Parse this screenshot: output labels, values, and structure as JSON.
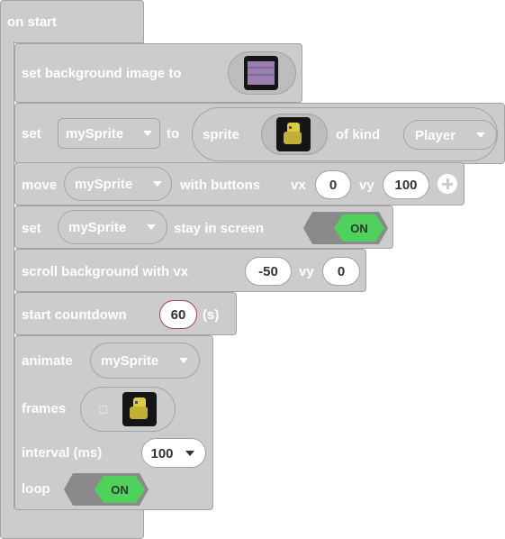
{
  "hat": {
    "label": "on start"
  },
  "blocks": {
    "set_bg": {
      "label": "set background image to",
      "image_icon": "background-image-thumbnail"
    },
    "set_sprite": {
      "set": "set",
      "variable": "mySprite",
      "to": "to",
      "sprite": "sprite",
      "sprite_icon": "player-sprite-thumbnail",
      "of_kind": "of kind",
      "kind": "Player"
    },
    "move": {
      "move": "move",
      "variable": "mySprite",
      "with_buttons": "with buttons",
      "vx_label": "vx",
      "vx": "0",
      "vy_label": "vy",
      "vy": "100",
      "expand_icon": "plus-circle-icon"
    },
    "stay": {
      "set": "set",
      "variable": "mySprite",
      "stay_in_screen": "stay in screen",
      "toggle": "ON"
    },
    "scroll": {
      "label": "scroll background with vx",
      "vx": "-50",
      "vy_label": "vy",
      "vy": "0"
    },
    "countdown": {
      "label": "start countdown",
      "value": "60",
      "unit": "(s)"
    },
    "animate": {
      "animate": "animate",
      "variable": "mySprite",
      "frames": "frames",
      "frame_icon": "player-frame-thumbnail",
      "add_frame_icon": "small-square-icon",
      "interval_label": "interval (ms)",
      "interval": "100",
      "loop": "loop",
      "loop_toggle": "ON"
    }
  },
  "colors": {
    "block": "#cccccc",
    "block_border": "#a3a3a3",
    "toggle_on": "#4fd15b",
    "text": "#ffffff",
    "value_text": "#333333"
  }
}
